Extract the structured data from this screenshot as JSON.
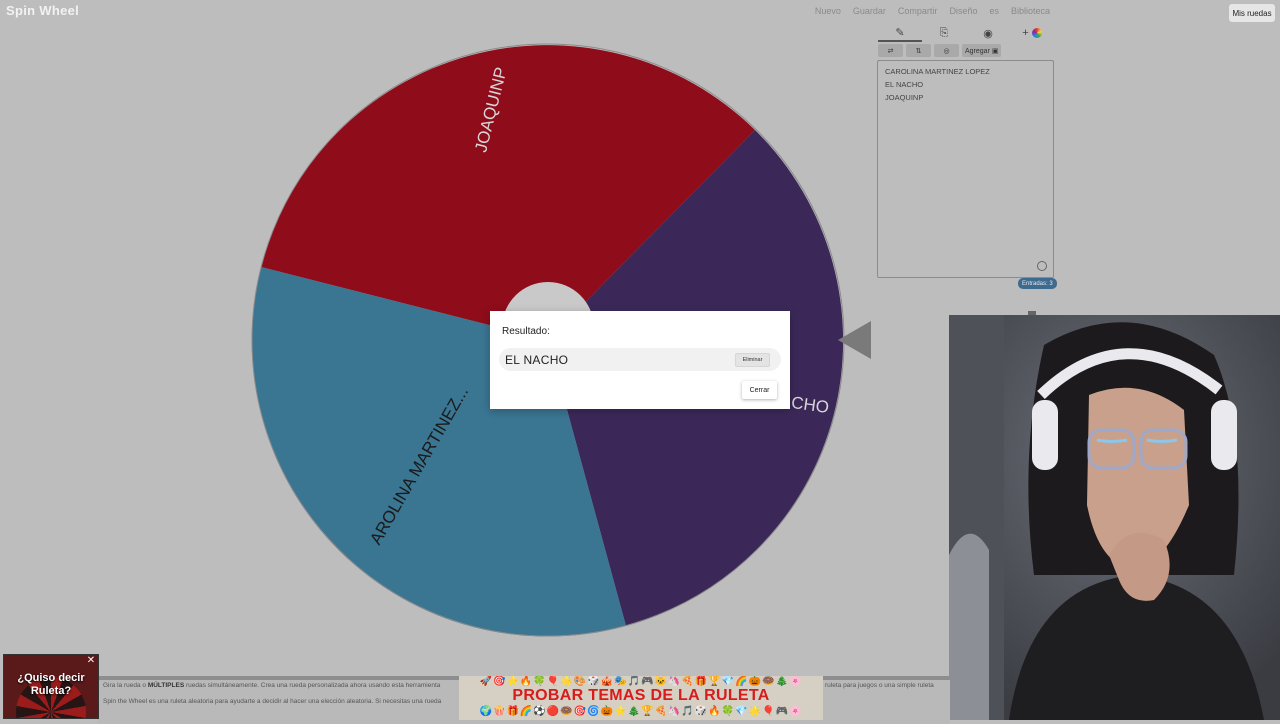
{
  "app": {
    "logo_text": "Spin Wheel"
  },
  "topnav": {
    "items": [
      "Nuevo",
      "Guardar",
      "Compartir",
      "Diseño",
      "es",
      "Biblioteca"
    ],
    "my_wheels": "Mis ruedas"
  },
  "wheel": {
    "segments": [
      {
        "label": "JOAQUINP",
        "color": "#8f0c1b"
      },
      {
        "label": "EL NACHO",
        "color": "#3b2858"
      },
      {
        "label": "CAROLINA MARTINEZ...",
        "color": "#3a7592"
      }
    ],
    "visible_labels": {
      "joaquinp": "JOAQUINP",
      "nacho_partial": "CHO",
      "carolina_partial": "AROLINA MARTINEZ..."
    }
  },
  "editor": {
    "tabs": [
      {
        "icon": "pencil-icon",
        "glyph": "✎"
      },
      {
        "icon": "clipboard-icon",
        "glyph": "⎘"
      },
      {
        "icon": "eye-slash-icon",
        "glyph": "◉"
      },
      {
        "icon": "add-color-icon",
        "glyph": "+"
      }
    ],
    "toolbar": {
      "shuffle": "⇄",
      "sort": "⇅",
      "image": "◎",
      "add_label": "Agregar ▣"
    },
    "entries": [
      "CAROLINA MARTINEZ LOPEZ",
      "EL NACHO",
      "JOAQUINP"
    ],
    "entry_count_label": "Entradas: 3"
  },
  "dialog": {
    "title": "Resultado:",
    "result": "EL NACHO",
    "remove_label": "Eliminar",
    "close_label": "Cerrar"
  },
  "bottom": {
    "line1_pre": "Gira la rueda o ",
    "line1_bold": "MÚLTIPLES",
    "line1_post": " ruedas simultáneamente. Crea una rueda personalizada ahora usando esta herramienta",
    "line2": "Spin the Wheel es una ruleta aleatoria para ayudarte a decidir al hacer una elección aleatoria. Si necesitas una rueda",
    "line1_right": "ruleta para juegos o una simple ruleta"
  },
  "ad": {
    "text": "¿Quiso decir Ruleta?",
    "close": "✕"
  },
  "banner": {
    "title": "PROBAR TEMAS DE LA RULETA",
    "emoji_row_top": "🚀🎯⭐🔥🍀🎈🌟🎨🎲🎪🎭🎵🎮🐱🦄🍕🎁🏆💎🌈🎃🍩🎄🌸",
    "emoji_row_bottom": "🌍🍿🎁🌈⚽🔴🍩🎯🌀🎃⭐🎄🏆🍕🦄🎵🎲🔥🍀💎🌟🎈🎮🌸"
  }
}
